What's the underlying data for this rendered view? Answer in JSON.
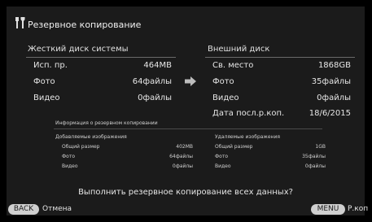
{
  "header": {
    "title": "Резервное копирование",
    "icon": "tools-icon"
  },
  "left": {
    "title": "Жесткий диск системы",
    "rows": [
      {
        "label": "Исп. пр.",
        "value": "464MB"
      },
      {
        "label": "Фото",
        "value": "64файлы"
      },
      {
        "label": "Видео",
        "value": "0файлы"
      }
    ]
  },
  "right": {
    "title": "Внешний диск",
    "rows": [
      {
        "label": "Св. место",
        "value": "1868GB"
      },
      {
        "label": "Фото",
        "value": "35файлы"
      },
      {
        "label": "Видео",
        "value": "0файлы"
      },
      {
        "label": "Дата посл.р.коп.",
        "value": "18/6/2015"
      }
    ]
  },
  "info": {
    "title": "Информация о резервном копировании",
    "added": {
      "title": "Добавляемые изображения",
      "rows": [
        {
          "label": "Общий размер",
          "value": "402MB"
        },
        {
          "label": "Фото",
          "value": "64файлы"
        },
        {
          "label": "Видео",
          "value": "0файлы"
        }
      ]
    },
    "removed": {
      "title": "Удаляемые изображения",
      "rows": [
        {
          "label": "Общий размер",
          "value": "1GB"
        },
        {
          "label": "Фото",
          "value": "35файлы"
        },
        {
          "label": "Видео",
          "value": "0файлы"
        }
      ]
    }
  },
  "prompt": "Выполнить резервное копирование всех данных?",
  "footer": {
    "back_key": "BACK",
    "back_label": "Отмена",
    "menu_key": "MENU",
    "menu_label": "Р.коп"
  },
  "colors": {
    "screen_bg": "#1b1b1b",
    "rule": "#6a6a6a",
    "pill": "#cfcfcf"
  }
}
